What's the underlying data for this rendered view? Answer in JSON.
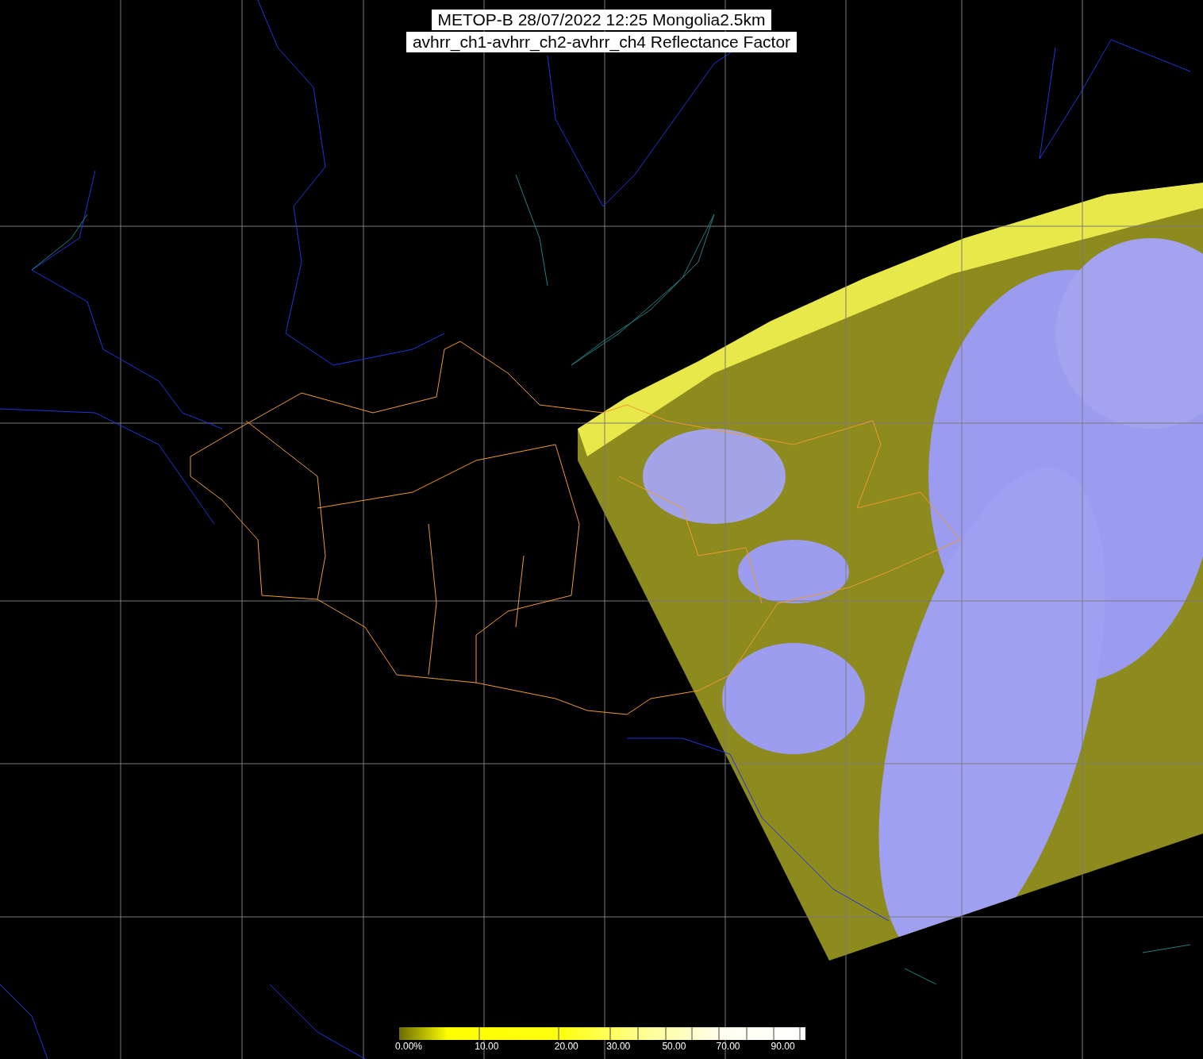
{
  "title_lines": [
    "METOP-B 28/07/2022 12:25 Mongolia2.5km",
    "avhrr_ch1-avhrr_ch2-avhrr_ch4 Reflectance Factor"
  ],
  "colorbar": {
    "labels": [
      "0.00%",
      "10.00",
      "20.00",
      "30.00",
      "50.00",
      "70.00",
      "90.00"
    ]
  }
}
